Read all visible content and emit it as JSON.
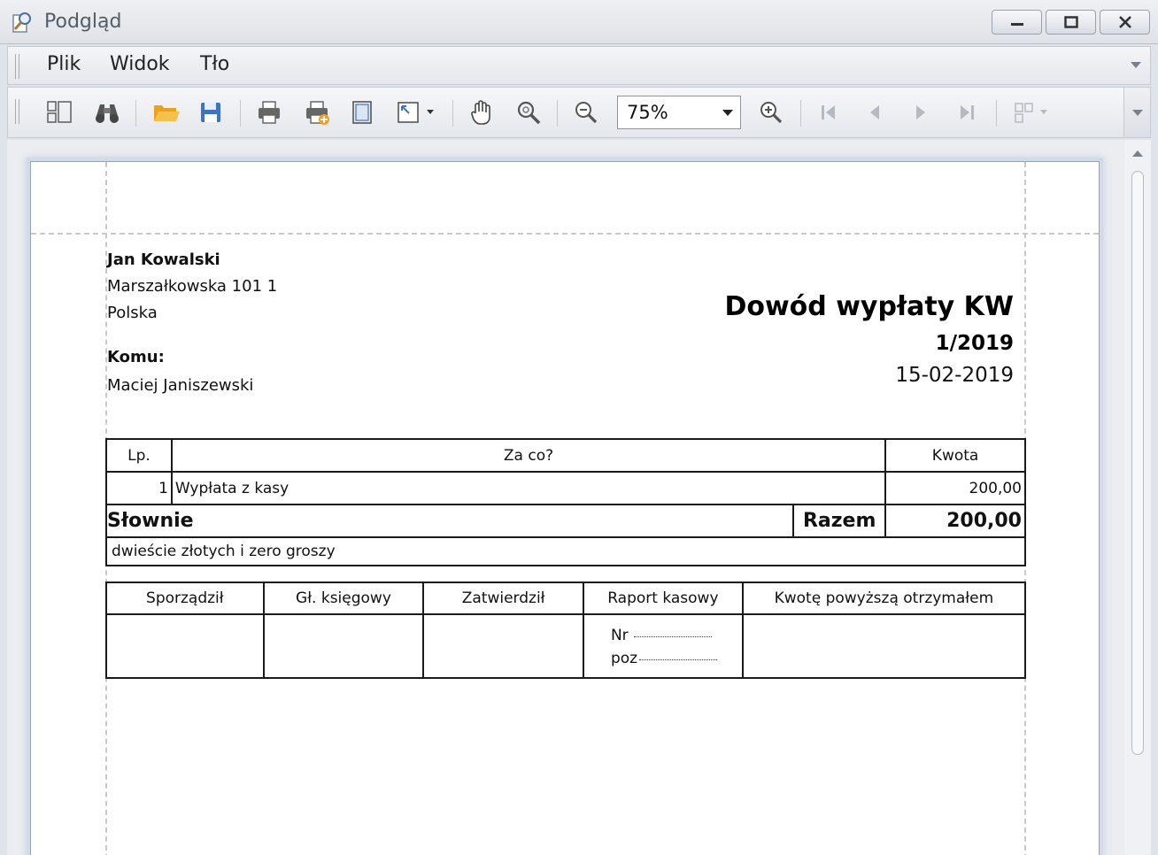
{
  "window": {
    "title": "Podgląd",
    "controls": [
      "minimize",
      "restore",
      "close"
    ]
  },
  "menu": {
    "items": [
      "Plik",
      "Widok",
      "Tło"
    ]
  },
  "toolbar": {
    "buttons": [
      {
        "icon": "thumbnails-icon"
      },
      {
        "icon": "binoculars-icon"
      },
      {
        "icon": "open-folder-icon"
      },
      {
        "icon": "save-icon"
      },
      {
        "icon": "print-icon"
      },
      {
        "icon": "quick-print-icon"
      },
      {
        "icon": "page-setup-icon"
      },
      {
        "icon": "scale-icon"
      },
      {
        "icon": "hand-tool-icon"
      },
      {
        "icon": "magnifier-icon"
      },
      {
        "icon": "zoom-out-icon"
      },
      {
        "icon": "zoom-in-icon"
      },
      {
        "icon": "first-page-icon"
      },
      {
        "icon": "previous-page-icon"
      },
      {
        "icon": "next-page-icon"
      },
      {
        "icon": "last-page-icon"
      },
      {
        "icon": "multi-page-icon"
      }
    ],
    "zoom": "75%"
  },
  "document": {
    "sender": {
      "name": "Jan  Kowalski",
      "street": "Marszałkowska 101 1",
      "country": "Polska"
    },
    "recipient_label": "Komu:",
    "recipient_name": "Maciej  Janiszewski",
    "title": "Dowód wypłaty KW",
    "number": "1/2019",
    "date": "15-02-2019",
    "items_table": {
      "headers": [
        "Lp.",
        "Za co?",
        "Kwota"
      ],
      "rows": [
        {
          "lp": "1",
          "description": "Wypłata z kasy",
          "amount": "200,00"
        }
      ],
      "words_label": "Słownie",
      "total_label": "Razem",
      "total": "200,00",
      "amount_in_words": "dwieście złotych i zero groszy"
    },
    "signatures": {
      "headers": [
        "Sporządził",
        "Gł. księgowy",
        "Zatwierdził",
        "Raport kasowy",
        "Kwotę powyższą otrzymałem"
      ],
      "nr_label": "Nr",
      "poz_label": "poz"
    }
  }
}
